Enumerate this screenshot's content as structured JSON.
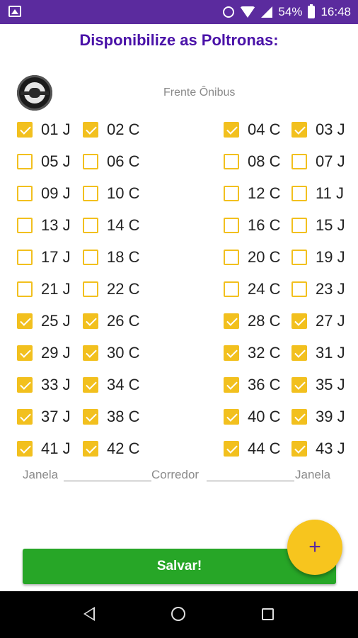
{
  "status_bar": {
    "battery": "54%",
    "time": "16:48"
  },
  "title": "Disponibilize as Poltronas:",
  "front_label": "Frente Ônibus",
  "seats": [
    {
      "label": "01 J",
      "checked": true
    },
    {
      "label": "02 C",
      "checked": true
    },
    {
      "label": "04 C",
      "checked": true
    },
    {
      "label": "03 J",
      "checked": true
    },
    {
      "label": "05 J",
      "checked": false
    },
    {
      "label": "06 C",
      "checked": false
    },
    {
      "label": "08 C",
      "checked": false
    },
    {
      "label": "07 J",
      "checked": false
    },
    {
      "label": "09 J",
      "checked": false
    },
    {
      "label": "10 C",
      "checked": false
    },
    {
      "label": "12 C",
      "checked": false
    },
    {
      "label": "11 J",
      "checked": false
    },
    {
      "label": "13 J",
      "checked": false
    },
    {
      "label": "14 C",
      "checked": false
    },
    {
      "label": "16 C",
      "checked": false
    },
    {
      "label": "15 J",
      "checked": false
    },
    {
      "label": "17 J",
      "checked": false
    },
    {
      "label": "18 C",
      "checked": false
    },
    {
      "label": "20 C",
      "checked": false
    },
    {
      "label": "19 J",
      "checked": false
    },
    {
      "label": "21 J",
      "checked": false
    },
    {
      "label": "22 C",
      "checked": false
    },
    {
      "label": "24 C",
      "checked": false
    },
    {
      "label": "23 J",
      "checked": false
    },
    {
      "label": "25 J",
      "checked": true
    },
    {
      "label": "26 C",
      "checked": true
    },
    {
      "label": "28 C",
      "checked": true
    },
    {
      "label": "27 J",
      "checked": true
    },
    {
      "label": "29 J",
      "checked": true
    },
    {
      "label": "30 C",
      "checked": true
    },
    {
      "label": "32 C",
      "checked": true
    },
    {
      "label": "31 J",
      "checked": true
    },
    {
      "label": "33 J",
      "checked": true
    },
    {
      "label": "34 C",
      "checked": true
    },
    {
      "label": "36 C",
      "checked": true
    },
    {
      "label": "35 J",
      "checked": true
    },
    {
      "label": "37 J",
      "checked": true
    },
    {
      "label": "38 C",
      "checked": true
    },
    {
      "label": "40 C",
      "checked": true
    },
    {
      "label": "39 J",
      "checked": true
    },
    {
      "label": "41 J",
      "checked": true
    },
    {
      "label": "42 C",
      "checked": true
    },
    {
      "label": "44 C",
      "checked": true
    },
    {
      "label": "43 J",
      "checked": true
    }
  ],
  "legend": {
    "left": "Janela",
    "middle": "Corredor",
    "right": "Janela"
  },
  "save_button": "Salvar!",
  "fab_icon": "plus-icon",
  "colors": {
    "status_bar": "#5b2b9e",
    "title": "#4a12a8",
    "checkbox": "#f2c01e",
    "save_button": "#27a627",
    "fab": "#f7c51e"
  }
}
